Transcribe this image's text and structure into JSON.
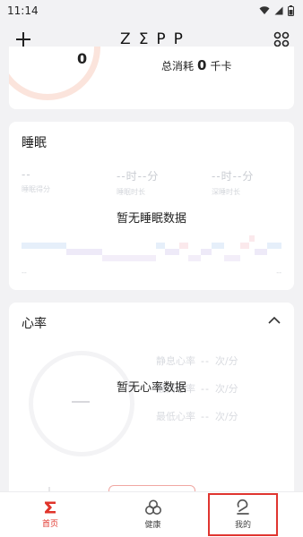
{
  "status_bar": {
    "time": "11:14",
    "icons": [
      "wifi-icon",
      "signal-icon",
      "battery-icon"
    ]
  },
  "header": {
    "logo": "ZΣPP",
    "add_icon": "plus-icon",
    "grid_icon": "grid-icon"
  },
  "activity": {
    "ring_value": "0",
    "calorie_label": "总消耗",
    "calorie_value": "0",
    "calorie_unit": "千卡"
  },
  "sleep": {
    "title": "睡眠",
    "stats": [
      {
        "value": "--",
        "label": "睡眠得分"
      },
      {
        "value": "--时--分",
        "label": "睡眠时长"
      },
      {
        "value": "--时--分",
        "label": "深睡时长"
      }
    ],
    "empty_text": "暂无睡眠数据",
    "footer_left": "--",
    "footer_right": "--"
  },
  "heart_rate": {
    "title": "心率",
    "collapse_icon": "chevron-up-icon",
    "ring_value": "--",
    "empty_text": "暂无心率数据",
    "stats": [
      {
        "label": "静息心率",
        "value": "--",
        "unit": "次/分"
      },
      {
        "label": "最高心率",
        "value": "--",
        "unit": "次/分"
      },
      {
        "label": "最低心率",
        "value": "--",
        "unit": "次/分"
      }
    ]
  },
  "bottom_nav": {
    "items": [
      {
        "label": "首页",
        "icon": "zepp-sigma-icon",
        "active": true
      },
      {
        "label": "健康",
        "icon": "health-rings-icon",
        "active": false
      },
      {
        "label": "我的",
        "icon": "profile-icon",
        "active": false
      }
    ]
  },
  "colors": {
    "accent": "#e0342b",
    "background": "#f2f2f4",
    "card": "#ffffff"
  }
}
